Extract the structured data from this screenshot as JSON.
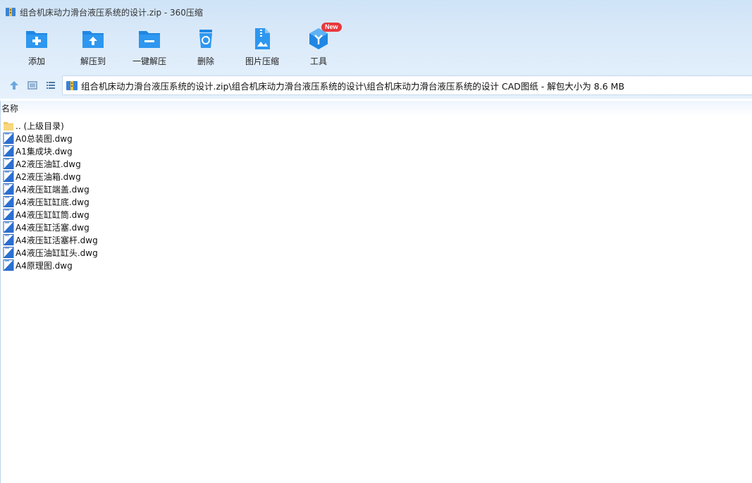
{
  "window": {
    "title": "组合机床动力滑台液压系统的设计.zip - 360压缩"
  },
  "toolbar": {
    "items": [
      {
        "label": "添加",
        "icon": "add-folder-icon"
      },
      {
        "label": "解压到",
        "icon": "extract-to-icon"
      },
      {
        "label": "一键解压",
        "icon": "one-click-extract-icon"
      },
      {
        "label": "删除",
        "icon": "recycle-bin-icon"
      },
      {
        "label": "图片压缩",
        "icon": "image-compress-icon"
      },
      {
        "label": "工具",
        "icon": "tools-cube-icon",
        "badge": "New"
      }
    ]
  },
  "navbar": {
    "path": "组合机床动力滑台液压系统的设计.zip\\组合机床动力滑台液压系统的设计\\组合机床动力滑台液压系统的设计 CAD图纸 - 解包大小为 8.6 MB"
  },
  "list": {
    "column_name": "名称",
    "parent": ".. (上级目录)",
    "files": [
      "A0总装图.dwg",
      "A1集成块.dwg",
      "A2液压油缸.dwg",
      "A2液压油箱.dwg",
      "A4液压缸端盖.dwg",
      "A4液压缸缸底.dwg",
      "A4液压缸缸筒.dwg",
      "A4液压缸活塞.dwg",
      "A4液压缸活塞杆.dwg",
      "A4液压油缸缸头.dwg",
      "A4原理图.dwg"
    ]
  },
  "colors": {
    "accent": "#2a8be0",
    "header_bg": "#d6e8f9",
    "badge": "#e8383d"
  }
}
